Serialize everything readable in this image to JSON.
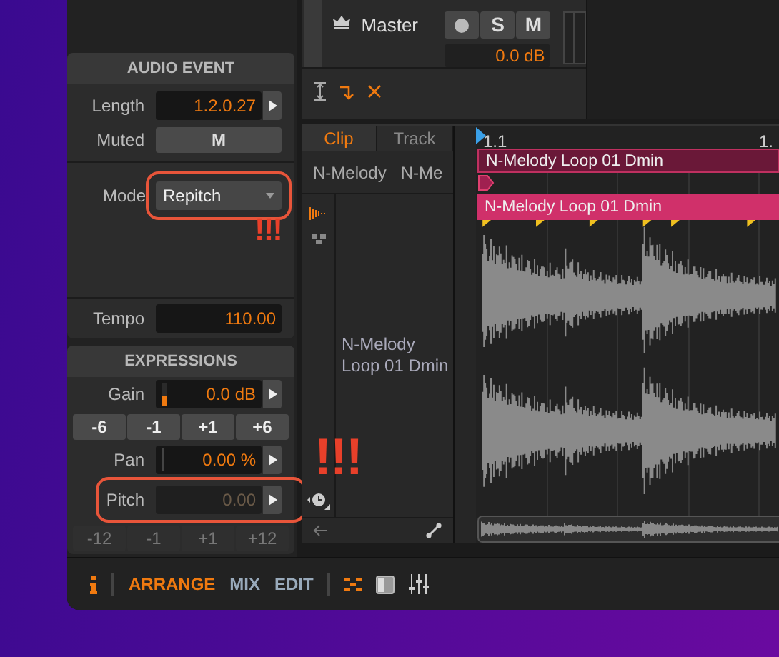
{
  "inspector": {
    "audio_event": {
      "title": "AUDIO EVENT",
      "length": {
        "label": "Length",
        "value": "1.2.0.27"
      },
      "muted": {
        "label": "Muted",
        "button": "M",
        "on": false
      },
      "mode": {
        "label": "Mode",
        "value": "Repitch",
        "highlighted": true
      },
      "tempo": {
        "label": "Tempo",
        "value": "110.00"
      }
    },
    "expressions": {
      "title": "EXPRESSIONS",
      "rows": [
        {
          "kind": "value",
          "label": "Gain",
          "value": "0.0 dB",
          "level": 0.45,
          "disabled": false
        },
        {
          "kind": "steps",
          "buttons": [
            "-6",
            "-1",
            "+1",
            "+6"
          ],
          "disabled": false
        },
        {
          "kind": "value",
          "label": "Pan",
          "value": "0.00 %",
          "level": 0,
          "disabled": false
        },
        {
          "kind": "value",
          "label": "Pitch",
          "value": "0.00",
          "disabled": true,
          "highlighted": true
        },
        {
          "kind": "steps",
          "buttons": [
            "-12",
            "-1",
            "+1",
            "+12"
          ],
          "disabled": true
        }
      ]
    }
  },
  "mixer": {
    "track": {
      "name": "Master",
      "buttons": [
        "S",
        "M"
      ],
      "volume": "0.0 dB"
    }
  },
  "clip_editor": {
    "tabs": [
      {
        "label": "Clip",
        "selected": true
      },
      {
        "label": "Track",
        "selected": false
      }
    ],
    "names": [
      "N-Melody",
      "N-Me"
    ],
    "clip_name": "N-Melody Loop 01 Dmin",
    "ruler": [
      "1.1",
      "1."
    ],
    "clips": [
      {
        "kind": "outline",
        "name": "N-Melody Loop 01 Dmin"
      },
      {
        "kind": "filled",
        "name": "N-Melody Loop 01 Dmin"
      }
    ]
  },
  "bottom_bar": {
    "views": [
      {
        "label": "ARRANGE",
        "selected": true
      },
      {
        "label": "MIX",
        "selected": false
      },
      {
        "label": "EDIT",
        "selected": false
      }
    ]
  },
  "annotations": [
    {
      "text": "!!!"
    },
    {
      "text": "!!!"
    }
  ]
}
